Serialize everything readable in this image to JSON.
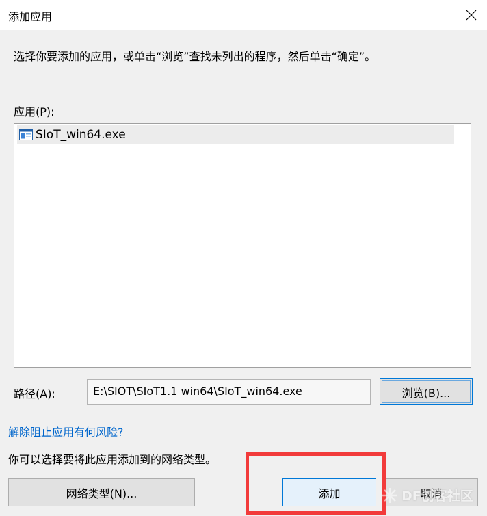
{
  "window": {
    "title": "添加应用"
  },
  "instruction": "选择你要添加的应用，或单击“浏览”查找未列出的程序，然后单击“确定”。",
  "apps": {
    "label": "应用(P):",
    "items": [
      {
        "name": "SIoT_win64.exe"
      }
    ]
  },
  "path": {
    "label": "路径(A):",
    "value": "E:\\SIOT\\SIoT1.1 win64\\SIoT_win64.exe"
  },
  "buttons": {
    "browse": "浏览(B)...",
    "network_types": "网络类型(N)...",
    "add": "添加",
    "cancel": "取消"
  },
  "risk_link": "解除阻止应用有何风险?",
  "network_hint": "你可以选择要将此应用添加到的网络类型。",
  "watermark": {
    "text": "DF创客社区"
  },
  "colors": {
    "accent": "#0078d7",
    "link": "#0066cc",
    "highlight": "#f23b3b"
  }
}
